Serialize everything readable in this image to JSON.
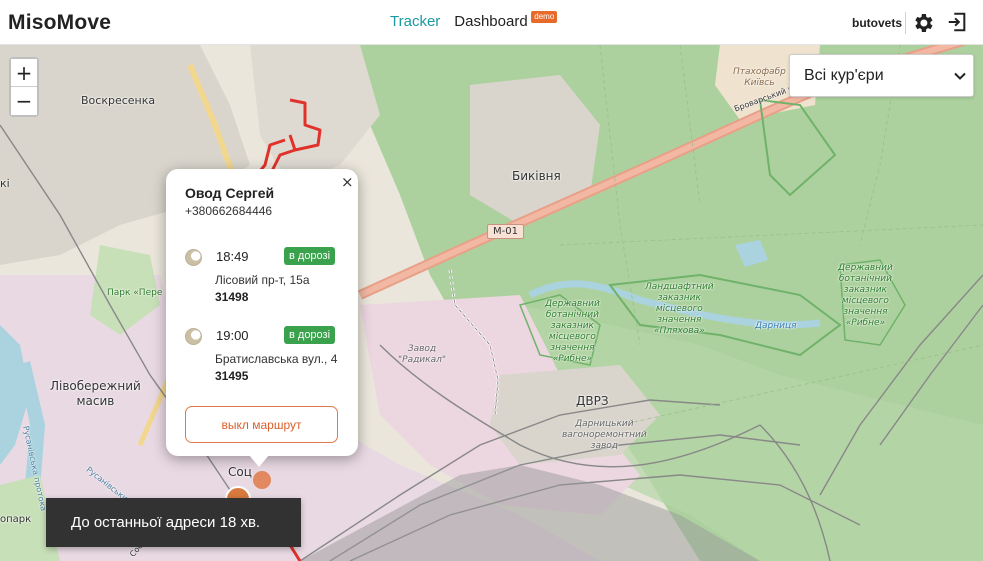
{
  "header": {
    "brand": "MisoMove",
    "nav_tracker": "Tracker",
    "nav_dashboard": "Dashboard",
    "demo_badge": "demo",
    "username": "butovets",
    "icons": [
      "gear-icon",
      "logout-icon"
    ]
  },
  "map_controls": {
    "zoom_in": "+",
    "zoom_out": "−"
  },
  "courier_filter": {
    "selected": "Всі кур'єри"
  },
  "map_labels": {
    "voskresenka": "Воскресенка",
    "bykivnia": "Биківня",
    "m01": "М-01",
    "brovarsky": "Броварський просп.",
    "ptakhofabryka": "Птахофабр\nКиївсь",
    "park_pere": "Парк «Пере",
    "zavod_radykal": "Завод\n\"Радикал\"",
    "livoberezhnyi": "Лівобережний\nмасив",
    "dvrz": "ДВРЗ",
    "darnytskyi_zavod": "Дарницький\nвагоноремонтний\nзавод",
    "zakaznyk_rybne_left": "Державний\nботанічний\nзаказник\nмісцевого\nзначення\n«Рибне»",
    "zakaznyk_pliakhova": "Ландшафтний\nзаказник\nмісцевого\nзначення\n«Пляхова»",
    "zakaznyk_rybne_right": "Державний\nботанічний\nзаказник\nмісцевого\nзначення\n«Рибне»",
    "darnytsia": "Дарниця",
    "rusanivska_protoka": "Русанівська протока",
    "rusanivskyi_kanal": "Русанівський канал",
    "ki": "кі",
    "opark": "опарк",
    "sots": "Соц",
    "sobor": "Собор"
  },
  "popup": {
    "close": "×",
    "courier_name": "Овод Сергей",
    "phone": "+380662684446",
    "stops": [
      {
        "time": "18:49",
        "status": "в дорозі",
        "address": "Лісовий пр-т, 15а",
        "order": "31498"
      },
      {
        "time": "19:00",
        "status": "в дорозі",
        "address": "Братиславська вул., 4",
        "order": "31495"
      }
    ],
    "route_button": "выкл маршрут"
  },
  "toast": {
    "text": "До останньої адреси 18 хв."
  },
  "colors": {
    "accent": "#1a9aa0",
    "status_green": "#3aa14c",
    "route_red": "#e0322a",
    "button_orange": "#d9602c",
    "demo_badge": "#e86a2a"
  }
}
